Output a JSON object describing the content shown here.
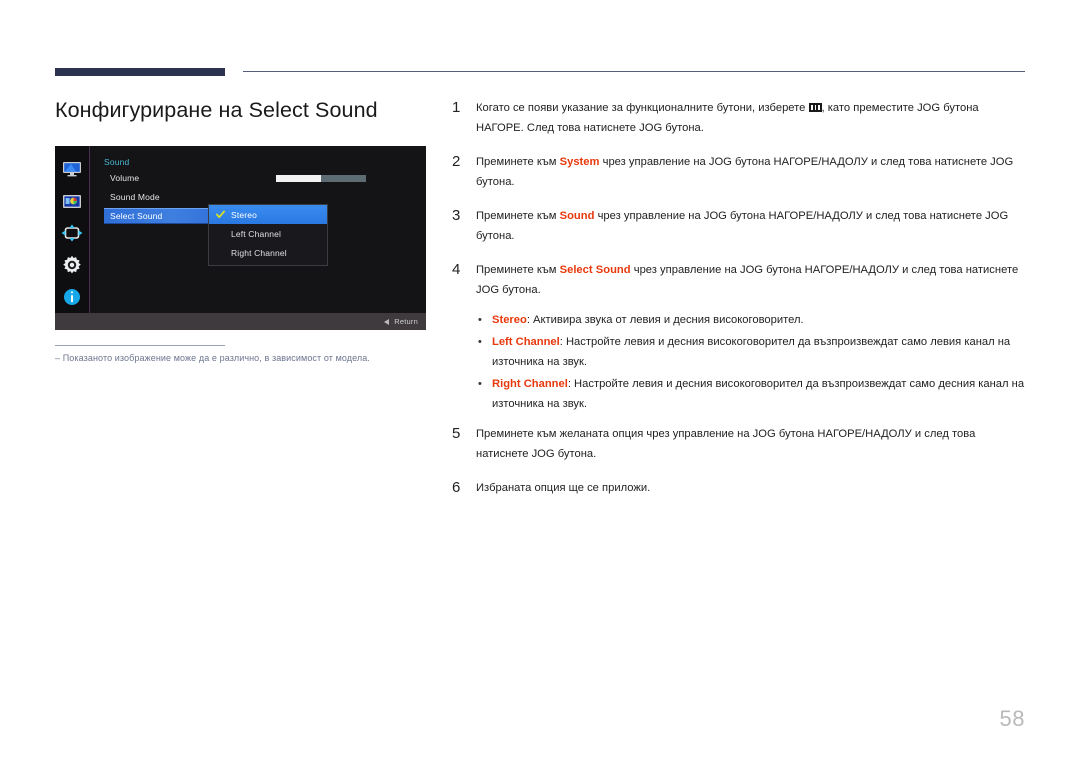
{
  "page": {
    "title": "Конфигуриране на Select Sound",
    "number": "58"
  },
  "osd": {
    "heading": "Sound",
    "sidebar_icons": [
      "monitor-icon",
      "picture-icon",
      "position-arrows-icon",
      "gear-icon",
      "info-icon"
    ],
    "rows": [
      {
        "label": "Volume",
        "value": "50"
      },
      {
        "label": "Sound Mode",
        "value": ""
      },
      {
        "label": "Select Sound",
        "value": ""
      }
    ],
    "volume_label": "Volume",
    "volume_value": "50",
    "volume_percent": 50,
    "sound_mode_label": "Sound Mode",
    "select_sound_label": "Select Sound",
    "submenu": {
      "items": [
        {
          "label": "Stereo",
          "selected": true
        },
        {
          "label": "Left Channel",
          "selected": false
        },
        {
          "label": "Right Channel",
          "selected": false
        }
      ]
    },
    "footer": {
      "return_label": "Return",
      "back-arrow-icon": "◀"
    },
    "colors": {
      "highlight_blue": "#2f6fd8",
      "heading_cyan": "#49b8cf",
      "check_yellow": "#d7e02a",
      "panel_dark": "#141417"
    }
  },
  "footnote": {
    "dash": "‒",
    "text": "Показаното изображение може да е различно, в зависимост от модела."
  },
  "steps": [
    {
      "num": "1",
      "parts": [
        {
          "t": "Когато се появи указание за функционалните бутони, изберете "
        },
        {
          "icon": "menu-icon"
        },
        {
          "t": ", като преместите JOG бутона НАГОРЕ. След това натиснете JOG бутона."
        }
      ]
    },
    {
      "num": "2",
      "parts": [
        {
          "t": "Преминете към "
        },
        {
          "t": "System",
          "red": true
        },
        {
          "t": " чрез управление на JOG бутона НАГОРЕ/НАДОЛУ и след това натиснете JOG бутона."
        }
      ]
    },
    {
      "num": "3",
      "parts": [
        {
          "t": "Преминете към "
        },
        {
          "t": "Sound",
          "red": true
        },
        {
          "t": " чрез управление на JOG бутона НАГОРЕ/НАДОЛУ и след това натиснете JOG бутона."
        }
      ]
    },
    {
      "num": "4",
      "parts": [
        {
          "t": "Преминете към "
        },
        {
          "t": "Select Sound",
          "red": true
        },
        {
          "t": " чрез управление на JOG бутона НАГОРЕ/НАДОЛУ и след това натиснете JOG бутона."
        }
      ]
    },
    {
      "num": "5",
      "parts": [
        {
          "t": "Преминете към желаната опция чрез управление на JOG бутона НАГОРЕ/НАДОЛУ и след това натиснете JOG бутона."
        }
      ]
    },
    {
      "num": "6",
      "parts": [
        {
          "t": "Избраната опция ще се приложи."
        }
      ]
    }
  ],
  "bullets": [
    {
      "dot": "•",
      "term": "Stereo",
      "rest": ": Активира звука от левия и десния високоговорител."
    },
    {
      "dot": "•",
      "term": "Left Channel",
      "rest": ": Настройте левия и десния високоговорител да възпроизвеждат само левия канал на източника на звук."
    },
    {
      "dot": "•",
      "term": "Right Channel",
      "rest": ": Настройте левия и десния високоговорител да възпроизвеждат само десния канал на източника на звук."
    }
  ]
}
